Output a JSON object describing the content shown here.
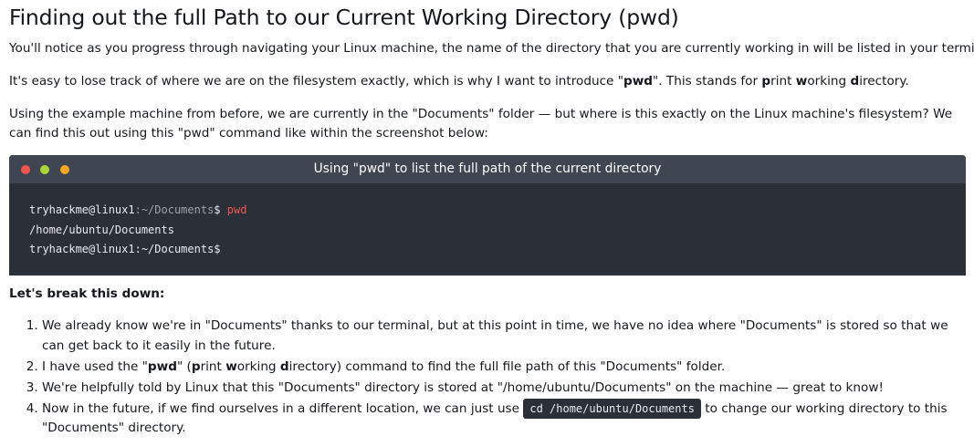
{
  "heading": "Finding out the full Path to our Current Working Directory (pwd)",
  "intro": {
    "p1": "You'll notice as you progress through navigating your Linux machine, the name of the directory that you are currently working in will be listed in your terminal.",
    "p2_before": "It's easy to lose track of where we are on the filesystem exactly, which is why I want to introduce \"",
    "p2_bold": "pwd",
    "p2_mid1": "\". This stands for ",
    "p2_p": "p",
    "p2_rint": "rint ",
    "p2_w": "w",
    "p2_orking": "orking ",
    "p2_d": "d",
    "p2_end": "irectory.",
    "p3": "Using the example machine from before, we are currently in the \"Documents\" folder — but where is this exactly on the Linux machine's filesystem? We can find this out using this \"pwd\" command like within the screenshot below:"
  },
  "terminal": {
    "title": "Using \"pwd\" to list the full path of the current directory",
    "line1_user": "tryhackme@linux1",
    "line1_path": ":~/Documents",
    "line1_prompt": "$ ",
    "line1_cmd": "pwd",
    "line2": "/home/ubuntu/Documents",
    "line3": "tryhackme@linux1:~/Documents$"
  },
  "breakdown": {
    "title": "Let's break this down:",
    "item1": "We already know we're in \"Documents\" thanks to our terminal, but at this point in time, we have no idea where \"Documents\" is stored so that we can get back to it easily in the future.",
    "item2_a": "I have used the \"",
    "item2_bold": "pwd",
    "item2_b": "\" (",
    "item2_p": "p",
    "item2_rint": "rint ",
    "item2_w": "w",
    "item2_orking": "orking ",
    "item2_d": "d",
    "item2_c": "irectory) command to find the full file path of this \"Documents\" folder.",
    "item3": "We're helpfully told by Linux that this \"Documents\" directory is stored at \"/home/ubuntu/Documents\" on the machine — great to know!",
    "item4_a": "Now in the future, if we find ourselves in a different location, we can just use ",
    "item4_code": "cd /home/ubuntu/Documents",
    "item4_b": " to change our working directory to this \"Documents\" directory."
  }
}
